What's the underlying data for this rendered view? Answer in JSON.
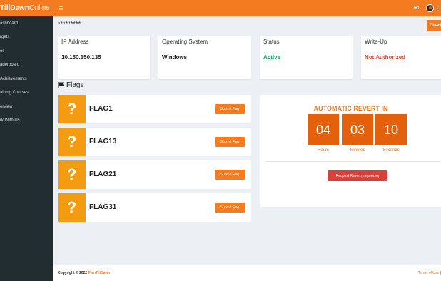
{
  "header": {
    "logo_bold": "PwnTillDawn",
    "logo_visible": "TillDawn",
    "logo_light": " Online",
    "menu_icon": "hamburger-icon",
    "mail_icon": "envelope-icon",
    "user_initial": "C"
  },
  "sidebar": {
    "items": [
      {
        "label": "ashboard"
      },
      {
        "label": "rgets"
      },
      {
        "label": "es"
      },
      {
        "label": "aderboard"
      },
      {
        "label": "Achievements"
      },
      {
        "label": "aining Courses"
      },
      {
        "label": "erview"
      },
      {
        "label": "rk With Us"
      }
    ]
  },
  "main": {
    "target_name": "*********",
    "check_button": "Check",
    "info_cards": [
      {
        "label": "IP Address",
        "value": "10.150.150.135"
      },
      {
        "label": "Operating System",
        "value": "Windows"
      },
      {
        "label": "Status",
        "value": "Active"
      },
      {
        "label": "Write-Up",
        "value": "Not Authorized"
      }
    ],
    "flags_title": "Flags",
    "flags": [
      {
        "name": "FLAG1",
        "icon": "?",
        "button": "Submit Flag"
      },
      {
        "name": "FLAG13",
        "icon": "?",
        "button": "Submit Flag"
      },
      {
        "name": "FLAG21",
        "icon": "?",
        "button": "Submit Flag"
      },
      {
        "name": "FLAG31",
        "icon": "?",
        "button": "Submit Flag"
      }
    ],
    "revert": {
      "title": "AUTOMATIC REVERT IN",
      "countdown": [
        {
          "value": "04",
          "label": "Hours"
        },
        {
          "value": "03",
          "label": "Minutes"
        },
        {
          "value": "10",
          "label": "Seconds"
        }
      ],
      "button": "Request Revert",
      "button_note": "(3 requests left)"
    }
  },
  "footer": {
    "copyright_prefix": "Copyright © 2022 ",
    "brand": "PwnTillDawn",
    "terms": "Terms of Use",
    "sep": " | "
  },
  "colors": {
    "accent": "#f47b20",
    "status_active": "#00a65a",
    "status_denied": "#dd4b39",
    "sidebar_bg": "#222d32",
    "flag_icon_bg": "#f39c12",
    "countdown_bg": "#e5600b",
    "revert_button": "#d9403a"
  }
}
